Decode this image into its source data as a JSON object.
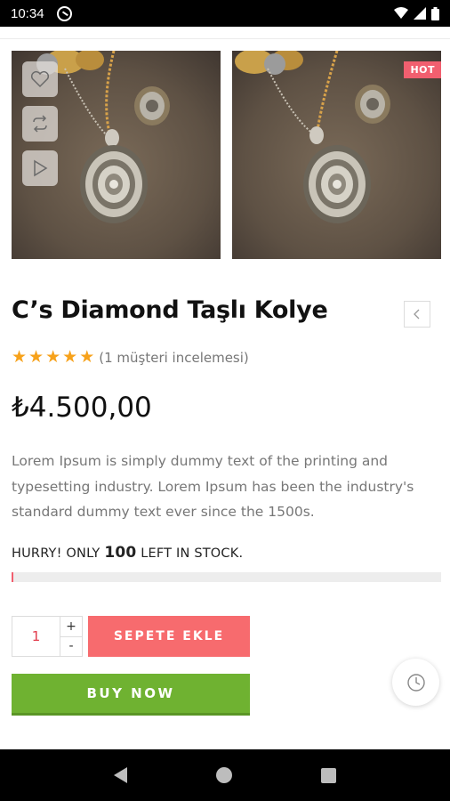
{
  "status_bar": {
    "time": "10:34",
    "icons": [
      "app-notification-icon",
      "wifi-icon",
      "cellular-icon",
      "battery-icon"
    ]
  },
  "gallery": {
    "badge": "HOT",
    "image_actions": [
      "heart-icon",
      "compare-icon",
      "play-icon"
    ]
  },
  "product": {
    "title": "C’s Diamond Taşlı Kolye",
    "rating_stars": 5,
    "review_text": "(1 müşteri incelemesi)",
    "price": "₺4.500,00",
    "description": "Lorem Ipsum is simply dummy text of the printing and typesetting industry. Lorem Ipsum has been the industry's standard dummy text ever since the 1500s."
  },
  "stock": {
    "prefix": "HURRY! ONLY",
    "count": "100",
    "suffix": "LEFT IN STOCK.",
    "fill_fraction": 0.004
  },
  "cart": {
    "quantity": "1",
    "plus": "+",
    "minus": "-",
    "add_to_cart_label": "SEPETE EKLE",
    "buy_now_label": "BUY NOW"
  },
  "colors": {
    "accent_red": "#f76b6e",
    "buy_green": "#6fb231",
    "star": "#f7a21b",
    "hot_badge": "#f15f6f"
  }
}
